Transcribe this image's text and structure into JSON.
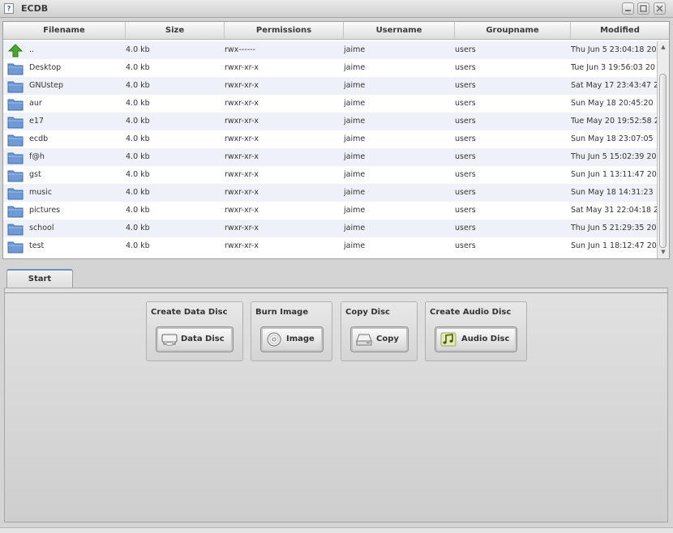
{
  "window": {
    "title": "ECDB",
    "app_icon": "?",
    "controls": [
      "minimize-icon",
      "maximize-icon",
      "close-icon"
    ]
  },
  "filelist": {
    "columns": [
      "Filename",
      "Size",
      "Permissions",
      "Username",
      "Groupname",
      "Modified"
    ],
    "rows": [
      {
        "icon": "up-arrow-icon",
        "name": "..",
        "size": "4.0 kb",
        "perm": "rwx------",
        "user": "jaime",
        "group": "users",
        "modified": "Thu Jun  5 23:04:18 20"
      },
      {
        "icon": "folder-icon",
        "name": "Desktop",
        "size": "4.0 kb",
        "perm": "rwxr-xr-x",
        "user": "jaime",
        "group": "users",
        "modified": "Tue Jun  3 19:56:03 20"
      },
      {
        "icon": "folder-icon",
        "name": "GNUstep",
        "size": "4.0 kb",
        "perm": "rwxr-xr-x",
        "user": "jaime",
        "group": "users",
        "modified": "Sat May 17 23:43:47 2"
      },
      {
        "icon": "folder-icon",
        "name": "aur",
        "size": "4.0 kb",
        "perm": "rwxr-xr-x",
        "user": "jaime",
        "group": "users",
        "modified": "Sun May 18 20:45:20"
      },
      {
        "icon": "folder-icon",
        "name": "e17",
        "size": "4.0 kb",
        "perm": "rwxr-xr-x",
        "user": "jaime",
        "group": "users",
        "modified": "Tue May 20 19:52:58 2"
      },
      {
        "icon": "folder-icon",
        "name": "ecdb",
        "size": "4.0 kb",
        "perm": "rwxr-xr-x",
        "user": "jaime",
        "group": "users",
        "modified": "Sun May 18 23:07:05"
      },
      {
        "icon": "folder-icon",
        "name": "f@h",
        "size": "4.0 kb",
        "perm": "rwxr-xr-x",
        "user": "jaime",
        "group": "users",
        "modified": "Thu Jun  5 15:02:39 20"
      },
      {
        "icon": "folder-icon",
        "name": "gst",
        "size": "4.0 kb",
        "perm": "rwxr-xr-x",
        "user": "jaime",
        "group": "users",
        "modified": "Sun Jun  1 13:11:47 20"
      },
      {
        "icon": "folder-icon",
        "name": "music",
        "size": "4.0 kb",
        "perm": "rwxr-xr-x",
        "user": "jaime",
        "group": "users",
        "modified": "Sun May 18 14:31:23"
      },
      {
        "icon": "folder-icon",
        "name": "pictures",
        "size": "4.0 kb",
        "perm": "rwxr-xr-x",
        "user": "jaime",
        "group": "users",
        "modified": "Sat May 31 22:04:18 2"
      },
      {
        "icon": "folder-icon",
        "name": "school",
        "size": "4.0 kb",
        "perm": "rwxr-xr-x",
        "user": "jaime",
        "group": "users",
        "modified": "Thu Jun  5 21:29:35 20"
      },
      {
        "icon": "folder-icon",
        "name": "test",
        "size": "4.0 kb",
        "perm": "rwxr-xr-x",
        "user": "jaime",
        "group": "users",
        "modified": "Sun Jun  1 18:12:47 20"
      }
    ]
  },
  "tabs": [
    {
      "label": "Start"
    }
  ],
  "groups": [
    {
      "title": "Create Data Disc",
      "button": "Data Disc",
      "icon": "drive-icon"
    },
    {
      "title": "Burn Image",
      "button": "Image",
      "icon": "cd-icon"
    },
    {
      "title": "Copy Disc",
      "button": "Copy",
      "icon": "harddisk-icon"
    },
    {
      "title": "Create Audio Disc",
      "button": "Audio Disc",
      "icon": "music-note-icon"
    }
  ],
  "colors": {
    "accent": "#6b8fc4",
    "folder": "#6f9ad6",
    "up_arrow": "#4aa82e",
    "row_alt": "#eef2f8"
  }
}
